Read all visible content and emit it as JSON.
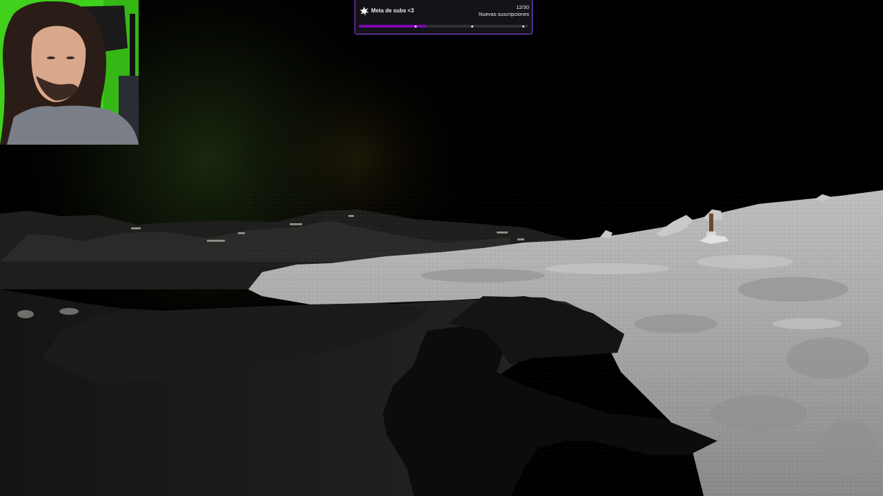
{
  "sub_goal": {
    "icon": "star-burst-icon",
    "title": "Meta de subs <3",
    "count": "12/30",
    "subtitle": "Nuevas suscripciones",
    "current": 12,
    "target": 30,
    "milestones": [
      10,
      20,
      30
    ],
    "colors": {
      "border": "#9146ff",
      "fill": "#8205b4",
      "track": "#2f2f35",
      "background": "#141418"
    }
  },
  "webcam": {
    "background_color": "#3fd11c"
  },
  "scene": {
    "description_icon": "lunar-surface"
  }
}
